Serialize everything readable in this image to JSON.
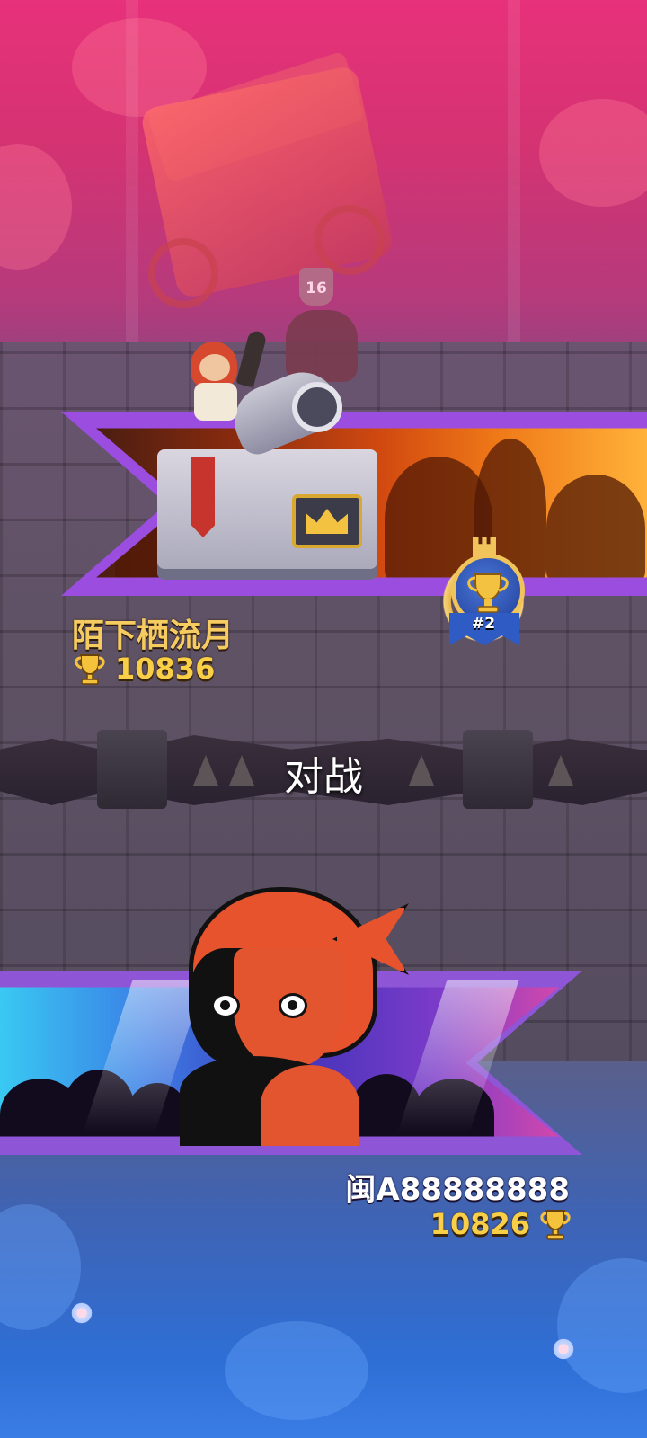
{
  "opponent": {
    "name": "陌下栖流月",
    "trophies": "10836",
    "rank_badge": "#2",
    "king_level": "16",
    "banner_theme": "orange"
  },
  "divider": {
    "label": "对战"
  },
  "player": {
    "name": "闽A88888888",
    "trophies": "10826",
    "banner_theme": "blue"
  },
  "icons": {
    "trophy": "trophy-icon",
    "rank": "rank-medal-icon"
  },
  "colors": {
    "trophy_text": "#f8cf47",
    "opponent_name": "#f6cc61",
    "player_name": "#ffffff",
    "banner_frame": "#9b4ddf"
  }
}
